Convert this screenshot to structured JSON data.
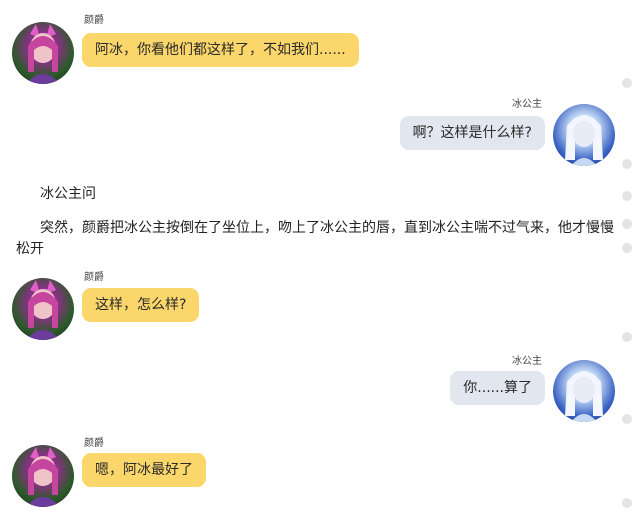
{
  "messages": [
    {
      "speaker": "颜爵",
      "text": "阿冰，你看他们都这样了，不如我们......"
    },
    {
      "speaker": "冰公主",
      "text": "啊？这样是什么样?"
    },
    {
      "speaker": "颜爵",
      "text": "这样，怎么样?"
    },
    {
      "speaker": "冰公主",
      "text": "你......算了"
    },
    {
      "speaker": "颜爵",
      "text": "嗯，阿冰最好了"
    }
  ],
  "narration": [
    "冰公主问",
    "突然，颜爵把冰公主按倒在了坐位上，吻上了冰公主的唇，直到冰公主喘不过气来，他才慢慢松开"
  ],
  "colors": {
    "left_bubble": "#fbd66b",
    "right_bubble": "#e2e6ee"
  }
}
